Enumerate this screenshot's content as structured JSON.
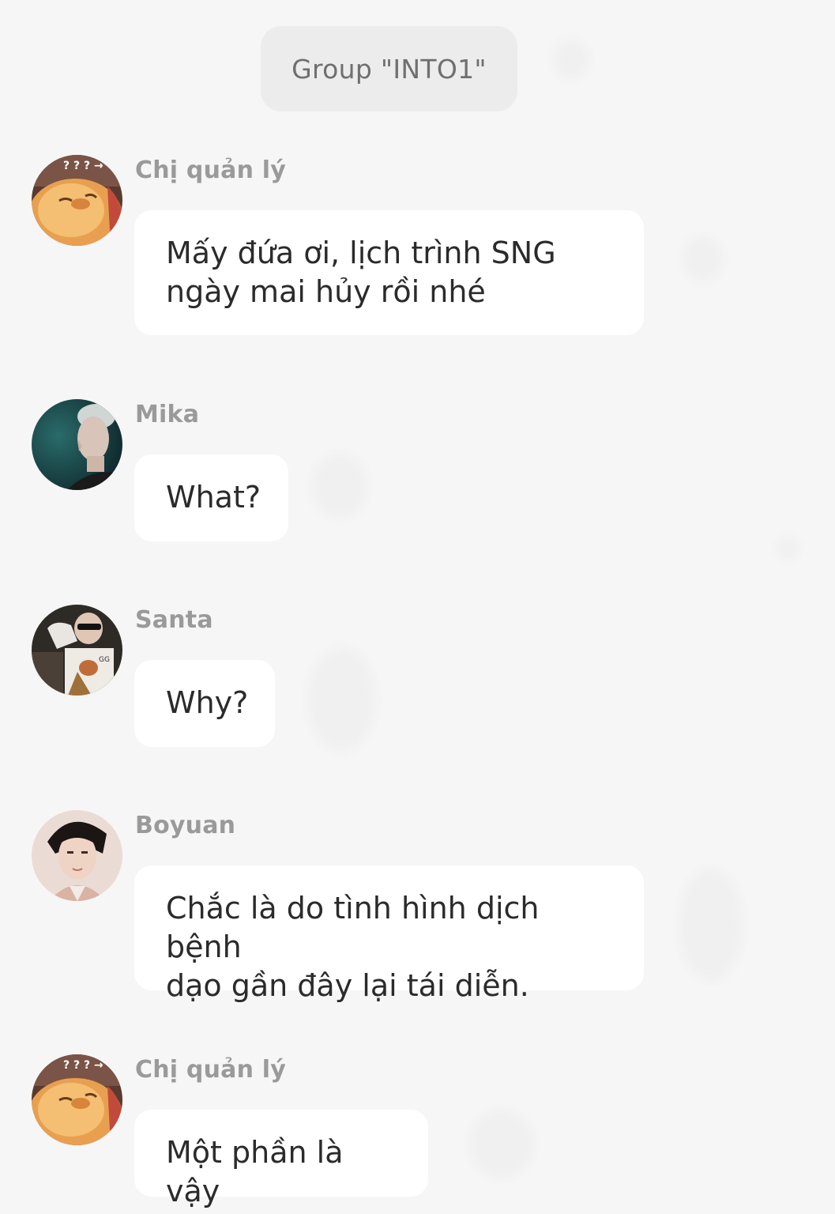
{
  "header": {
    "group_label": "Group \"INTO1\""
  },
  "messages": [
    {
      "sender": "Chị quản lý",
      "avatar": "chick-avatar",
      "text": "Mấy đứa ơi, lịch trình SNG\nngày mai hủy rồi nhé"
    },
    {
      "sender": "Mika",
      "avatar": "mika-avatar",
      "text": "What?"
    },
    {
      "sender": "Santa",
      "avatar": "santa-avatar",
      "text": "Why?"
    },
    {
      "sender": "Boyuan",
      "avatar": "boyuan-avatar",
      "text": "Chắc là do tình hình dịch bệnh\ndạo gần đây lại tái diễn."
    },
    {
      "sender": "Chị quản lý",
      "avatar": "chick-avatar",
      "text": "Một phần là vậy"
    }
  ],
  "colors": {
    "background": "#f6f6f6",
    "bubble": "#ffffff",
    "pill": "#ececec",
    "sender_text": "#9a9a9a",
    "message_text": "#2b2b2b"
  }
}
